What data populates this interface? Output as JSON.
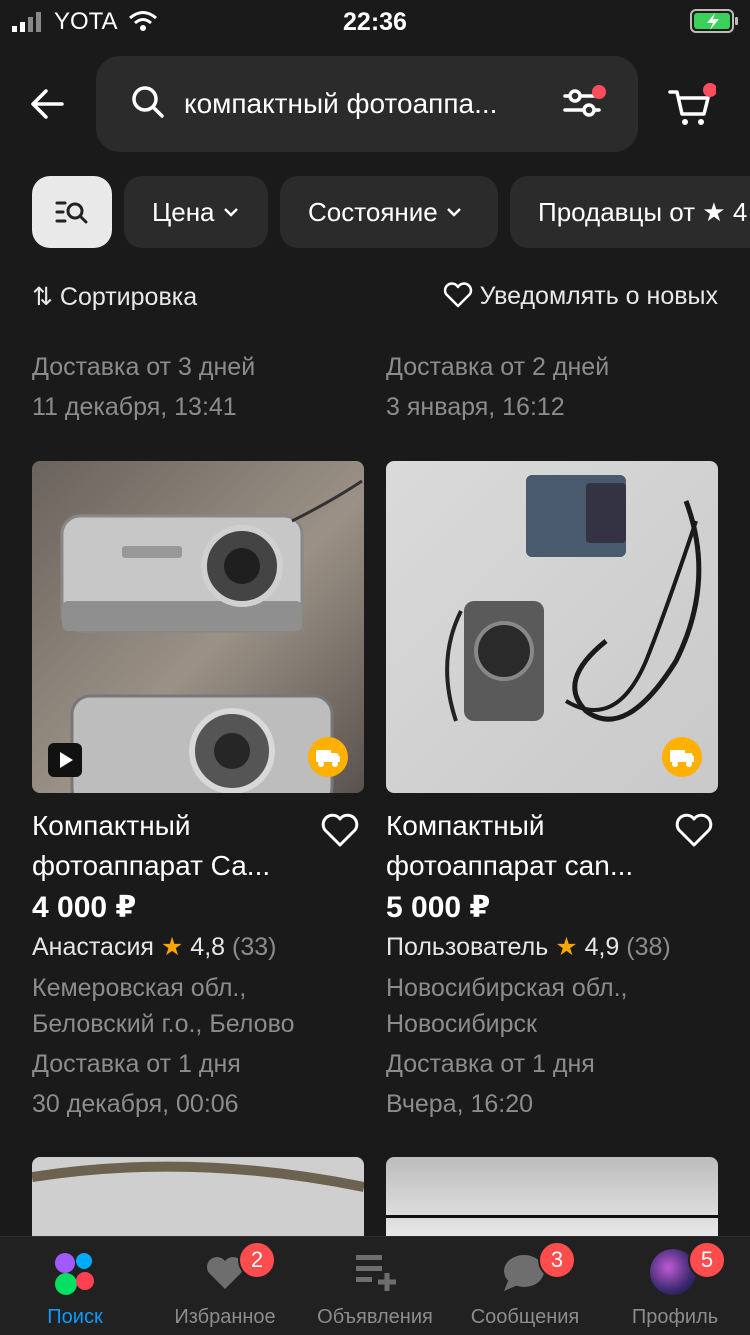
{
  "status_bar": {
    "carrier": "YOTA",
    "time": "22:36"
  },
  "search": {
    "query": "компактный фотоаппа...",
    "cart_dot": true
  },
  "filters": [
    {
      "label": "Цена"
    },
    {
      "label": "Состояние"
    },
    {
      "label": "Продавцы от ★ 4"
    }
  ],
  "sort_label": "Сортировка",
  "notify_label": "Уведомлять о новых",
  "prev_items": [
    {
      "delivery": "Доставка от 3 дней",
      "date": "11 декабря, 13:41"
    },
    {
      "delivery": "Доставка от 2 дней",
      "date": "3 января, 16:12"
    }
  ],
  "items": [
    {
      "title_line1": "Компактный",
      "title_line2": "фотоаппарат Са...",
      "price": "4 000 ₽",
      "seller": "Анастасия",
      "rating": "4,8",
      "reviews": "(33)",
      "location_line1": "Кемеровская обл.,",
      "location_line2": "Беловский г.о., Белово",
      "delivery": "Доставка от 1 дня",
      "date": "30 декабря, 00:06"
    },
    {
      "title_line1": "Компактный",
      "title_line2": "фотоаппарат can...",
      "price": "5 000 ₽",
      "seller": "Пользователь",
      "rating": "4,9",
      "reviews": "(38)",
      "location_line1": "Новосибирская обл.,",
      "location_line2": "Новосибирск",
      "delivery": "Доставка от 1 дня",
      "date": "Вчера, 16:20"
    }
  ],
  "tabs": [
    {
      "label": "Поиск",
      "badge": ""
    },
    {
      "label": "Избранное",
      "badge": "2"
    },
    {
      "label": "Объявления",
      "badge": ""
    },
    {
      "label": "Сообщения",
      "badge": "3"
    },
    {
      "label": "Профиль",
      "badge": "5"
    }
  ],
  "colors": {
    "accent": "#0a9bff",
    "badge": "#ff4d4d",
    "star": "#f7a600",
    "delivery_badge": "#ffb000"
  }
}
